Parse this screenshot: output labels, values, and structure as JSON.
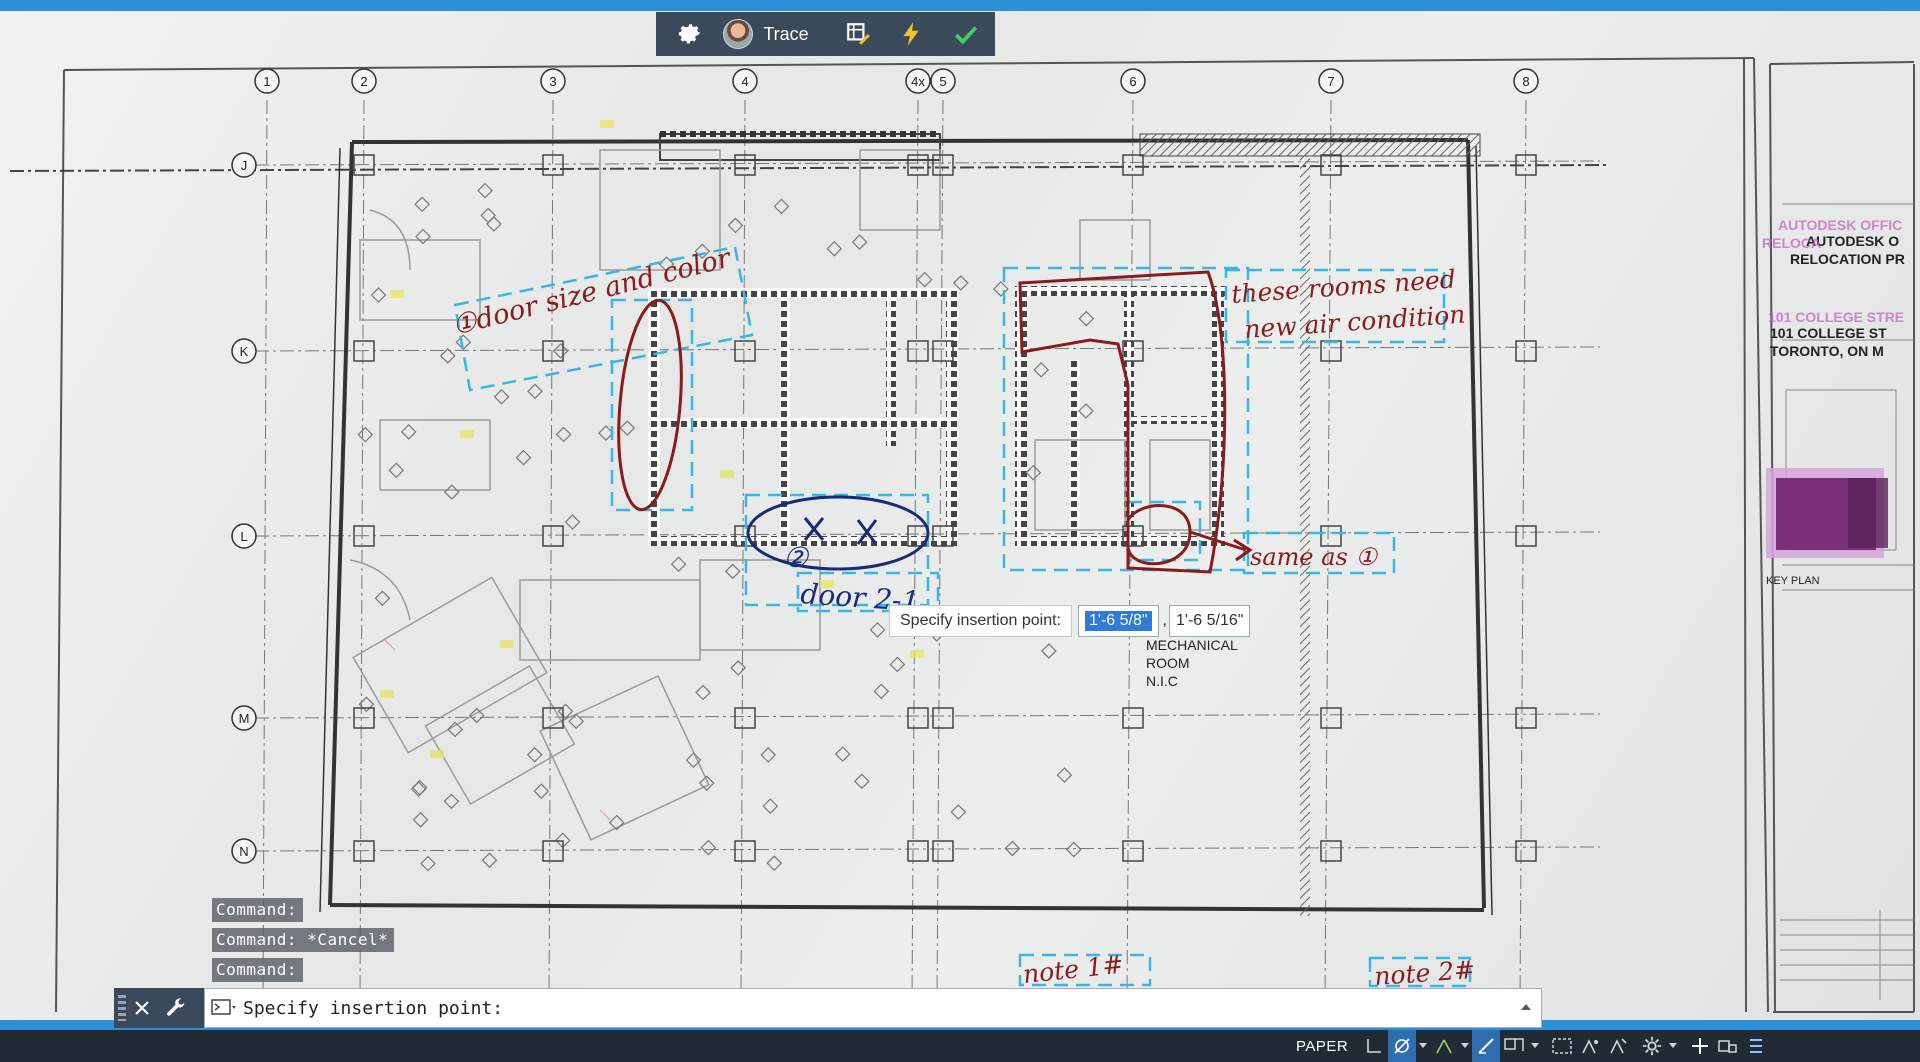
{
  "toolbar": {
    "trace_label": "Trace",
    "icons": [
      "gear-icon",
      "avatar",
      "markup-import-icon",
      "lightning-icon",
      "check-icon"
    ]
  },
  "drawing": {
    "grid_columns": [
      "1",
      "2",
      "3",
      "4",
      "4x",
      "5",
      "6",
      "7",
      "8"
    ],
    "grid_rows": [
      "J",
      "K",
      "L",
      "M",
      "N"
    ],
    "room_label": [
      "MECHANICAL",
      "ROOM",
      "N.I.C"
    ],
    "title_block": {
      "company": "AUTODESK O",
      "company_pink": "AUTODESK OFFIC",
      "project": "RELOCATION PR",
      "project_pink": "RELOCA",
      "address1": "101 COLLEGE ST",
      "address1_pink": "101 COLLEGE STRE",
      "address2": "TORONTO, ON M",
      "key_plan": "KEY PLAN"
    },
    "markups": {
      "note_door": "①door size and color",
      "note_rooms_1": "these rooms need",
      "note_rooms_2": "new air condition",
      "note_same": "same as ①",
      "note_door2": "door 2-1",
      "note_1": "note 1#",
      "note_2": "note 2#",
      "circle_num": "②"
    }
  },
  "dynamic_input": {
    "prompt": "Specify insertion point:",
    "x_value": "1'-6 5/8\"",
    "separator": ",",
    "y_value": "1'-6 5/16\""
  },
  "command_history": [
    "Command:",
    "Command: *Cancel*",
    "Command:"
  ],
  "command_line": {
    "text": "Specify insertion point:",
    "icons": [
      "close-icon",
      "wrench-icon",
      "command-prompt-icon",
      "chevron-up-icon"
    ]
  },
  "status_bar": {
    "paper_label": "PAPER",
    "icons": [
      "grid-icon",
      "snap-icon",
      "ortho-icon",
      "polar-icon",
      "osnap-icon",
      "lineweight-icon",
      "transparency-icon",
      "annotation-scale-icon",
      "annotation-visibility-icon",
      "workspace-gear-icon",
      "plus-icon",
      "isolate-icon",
      "customize-icon"
    ]
  },
  "colors": {
    "accent_blue": "#2b90d6",
    "toolbar_bg": "#3a4a5b",
    "markup_red": "#8b1a1a",
    "markup_blue": "#1a2a7a",
    "dashed_cyan": "#39b6e6",
    "status_bg": "#222b35"
  }
}
